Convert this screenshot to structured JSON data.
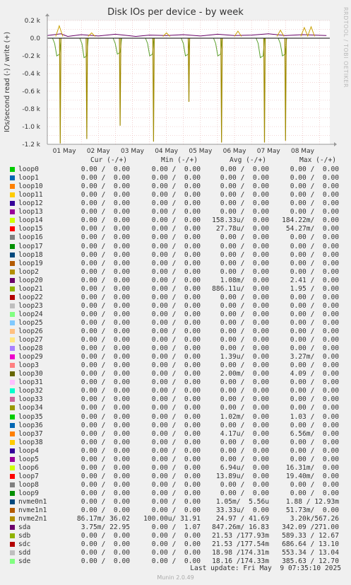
{
  "chart_data": {
    "type": "line",
    "title": "Disk IOs per device - by week",
    "ylabel": "IOs/second read (-) / write (+)",
    "ylim": [
      -1200,
      200
    ],
    "yticks": [
      {
        "v": 200,
        "label": "0.2 k"
      },
      {
        "v": 0,
        "label": "0.0"
      },
      {
        "v": -200,
        "label": "-0.2 k"
      },
      {
        "v": -400,
        "label": "-0.4 k"
      },
      {
        "v": -600,
        "label": "-0.6 k"
      },
      {
        "v": -800,
        "label": "-0.8 k"
      },
      {
        "v": -1000,
        "label": "-1.0 k"
      },
      {
        "v": -1200,
        "label": "-1.2 k"
      }
    ],
    "xlim": [
      0,
      8.3
    ],
    "xticks": [
      {
        "v": 0.5,
        "label": "01 May"
      },
      {
        "v": 1.5,
        "label": "02 May"
      },
      {
        "v": 2.5,
        "label": "03 May"
      },
      {
        "v": 3.5,
        "label": "04 May"
      },
      {
        "v": 4.5,
        "label": "05 May"
      },
      {
        "v": 5.5,
        "label": "06 May"
      },
      {
        "v": 6.5,
        "label": "07 May"
      },
      {
        "v": 7.5,
        "label": "08 May"
      }
    ],
    "grid": true,
    "colors": {
      "background": "#f0f0f0",
      "plot": "#ffffff",
      "grid": "#e8b0b0",
      "zero": "#000000",
      "axis": "#999999"
    },
    "series": [
      {
        "name": "nvme2n1",
        "color": "#a08a00",
        "spikes": [
          {
            "x": 0.38,
            "y": -1190
          },
          {
            "x": 1.16,
            "y": -1140
          },
          {
            "x": 2.14,
            "y": -990
          },
          {
            "x": 3.12,
            "y": -1170
          },
          {
            "x": 4.16,
            "y": -720
          },
          {
            "x": 5.12,
            "y": -1180
          },
          {
            "x": 6.38,
            "y": -1180
          },
          {
            "x": 7.0,
            "y": -1160
          }
        ]
      },
      {
        "name": "sdc",
        "color": "#5aa02c",
        "dips": [
          {
            "x": 0.32,
            "y": -200
          },
          {
            "x": 1.12,
            "y": -220
          },
          {
            "x": 2.1,
            "y": -180
          },
          {
            "x": 3.05,
            "y": -200
          },
          {
            "x": 4.1,
            "y": -200
          },
          {
            "x": 5.05,
            "y": -200
          },
          {
            "x": 6.3,
            "y": -220
          },
          {
            "x": 6.95,
            "y": -200
          }
        ]
      },
      {
        "name": "sda",
        "color": "#660066",
        "values": [
          {
            "x": 0.0,
            "y": 30
          },
          {
            "x": 0.4,
            "y": 50
          },
          {
            "x": 0.6,
            "y": 20
          },
          {
            "x": 1.0,
            "y": 40
          },
          {
            "x": 1.5,
            "y": 25
          },
          {
            "x": 2.0,
            "y": 45
          },
          {
            "x": 2.6,
            "y": 20
          },
          {
            "x": 3.0,
            "y": 35
          },
          {
            "x": 3.5,
            "y": 30
          },
          {
            "x": 4.0,
            "y": 40
          },
          {
            "x": 4.5,
            "y": 25
          },
          {
            "x": 5.0,
            "y": 45
          },
          {
            "x": 5.5,
            "y": 30
          },
          {
            "x": 6.0,
            "y": 35
          },
          {
            "x": 6.5,
            "y": 50
          },
          {
            "x": 7.0,
            "y": 30
          },
          {
            "x": 7.5,
            "y": 40
          },
          {
            "x": 8.2,
            "y": 30
          }
        ]
      },
      {
        "name": "nvme1n1",
        "color": "#a04000",
        "peaks": [
          {
            "x": 0.35,
            "y": 140
          },
          {
            "x": 1.3,
            "y": 60
          },
          {
            "x": 3.5,
            "y": 60
          },
          {
            "x": 5.6,
            "y": 80
          },
          {
            "x": 6.85,
            "y": 90
          },
          {
            "x": 7.55,
            "y": 120
          },
          {
            "x": 7.75,
            "y": 130
          }
        ]
      }
    ]
  },
  "side_text": "RRDTOOL / TOBI OETIKER",
  "legend": {
    "headers": {
      "cur": "Cur (-/+)",
      "min": "Min (-/+)",
      "avg": "Avg (-/+)",
      "max": "Max (-/+)"
    },
    "rows": [
      {
        "name": "loop0",
        "color": "#00cc00",
        "cur": "0.00 /  0.00",
        "min": "0.00 /  0.00",
        "avg": "0.00 /  0.00",
        "max": "0.00 /  0.00"
      },
      {
        "name": "loop1",
        "color": "#0066b3",
        "cur": "0.00 /  0.00",
        "min": "0.00 /  0.00",
        "avg": "0.00 /  0.00",
        "max": "0.00 /  0.00"
      },
      {
        "name": "loop10",
        "color": "#ff8000",
        "cur": "0.00 /  0.00",
        "min": "0.00 /  0.00",
        "avg": "0.00 /  0.00",
        "max": "0.00 /  0.00"
      },
      {
        "name": "loop11",
        "color": "#ffcc00",
        "cur": "0.00 /  0.00",
        "min": "0.00 /  0.00",
        "avg": "0.00 /  0.00",
        "max": "0.00 /  0.00"
      },
      {
        "name": "loop12",
        "color": "#330099",
        "cur": "0.00 /  0.00",
        "min": "0.00 /  0.00",
        "avg": "0.00 /  0.00",
        "max": "0.00 /  0.00"
      },
      {
        "name": "loop13",
        "color": "#990099",
        "cur": "0.00 /  0.00",
        "min": "0.00 /  0.00",
        "avg": "0.00 /  0.00",
        "max": "0.00 /  0.00"
      },
      {
        "name": "loop14",
        "color": "#ccff00",
        "cur": "0.00 /  0.00",
        "min": "0.00 /  0.00",
        "avg": "158.33u/  0.00",
        "max": "184.22m/  0.00"
      },
      {
        "name": "loop15",
        "color": "#ff0000",
        "cur": "0.00 /  0.00",
        "min": "0.00 /  0.00",
        "avg": "27.78u/  0.00",
        "max": "54.27m/  0.00"
      },
      {
        "name": "loop16",
        "color": "#808080",
        "cur": "0.00 /  0.00",
        "min": "0.00 /  0.00",
        "avg": "0.00 /  0.00",
        "max": "0.00 /  0.00"
      },
      {
        "name": "loop17",
        "color": "#008f00",
        "cur": "0.00 /  0.00",
        "min": "0.00 /  0.00",
        "avg": "0.00 /  0.00",
        "max": "0.00 /  0.00"
      },
      {
        "name": "loop18",
        "color": "#00487d",
        "cur": "0.00 /  0.00",
        "min": "0.00 /  0.00",
        "avg": "0.00 /  0.00",
        "max": "0.00 /  0.00"
      },
      {
        "name": "loop19",
        "color": "#b35a00",
        "cur": "0.00 /  0.00",
        "min": "0.00 /  0.00",
        "avg": "0.00 /  0.00",
        "max": "0.00 /  0.00"
      },
      {
        "name": "loop2",
        "color": "#b38f00",
        "cur": "0.00 /  0.00",
        "min": "0.00 /  0.00",
        "avg": "0.00 /  0.00",
        "max": "0.00 /  0.00"
      },
      {
        "name": "loop20",
        "color": "#6b006b",
        "cur": "0.00 /  0.00",
        "min": "0.00 /  0.00",
        "avg": "1.08m/  0.00",
        "max": "2.41 /  0.00"
      },
      {
        "name": "loop21",
        "color": "#8fb300",
        "cur": "0.00 /  0.00",
        "min": "0.00 /  0.00",
        "avg": "886.11u/  0.00",
        "max": "1.95 /  0.00"
      },
      {
        "name": "loop22",
        "color": "#b30000",
        "cur": "0.00 /  0.00",
        "min": "0.00 /  0.00",
        "avg": "0.00 /  0.00",
        "max": "0.00 /  0.00"
      },
      {
        "name": "loop23",
        "color": "#bebebe",
        "cur": "0.00 /  0.00",
        "min": "0.00 /  0.00",
        "avg": "0.00 /  0.00",
        "max": "0.00 /  0.00"
      },
      {
        "name": "loop24",
        "color": "#80ff80",
        "cur": "0.00 /  0.00",
        "min": "0.00 /  0.00",
        "avg": "0.00 /  0.00",
        "max": "0.00 /  0.00"
      },
      {
        "name": "loop25",
        "color": "#80c9ff",
        "cur": "0.00 /  0.00",
        "min": "0.00 /  0.00",
        "avg": "0.00 /  0.00",
        "max": "0.00 /  0.00"
      },
      {
        "name": "loop26",
        "color": "#ffc080",
        "cur": "0.00 /  0.00",
        "min": "0.00 /  0.00",
        "avg": "0.00 /  0.00",
        "max": "0.00 /  0.00"
      },
      {
        "name": "loop27",
        "color": "#ffe680",
        "cur": "0.00 /  0.00",
        "min": "0.00 /  0.00",
        "avg": "0.00 /  0.00",
        "max": "0.00 /  0.00"
      },
      {
        "name": "loop28",
        "color": "#aa80ff",
        "cur": "0.00 /  0.00",
        "min": "0.00 /  0.00",
        "avg": "0.00 /  0.00",
        "max": "0.00 /  0.00"
      },
      {
        "name": "loop29",
        "color": "#ee00cc",
        "cur": "0.00 /  0.00",
        "min": "0.00 /  0.00",
        "avg": "1.39u/  0.00",
        "max": "3.27m/  0.00"
      },
      {
        "name": "loop3",
        "color": "#ff8080",
        "cur": "0.00 /  0.00",
        "min": "0.00 /  0.00",
        "avg": "0.00 /  0.00",
        "max": "0.00 /  0.00"
      },
      {
        "name": "loop30",
        "color": "#666600",
        "cur": "0.00 /  0.00",
        "min": "0.00 /  0.00",
        "avg": "2.00m/  0.00",
        "max": "4.09 /  0.00"
      },
      {
        "name": "loop31",
        "color": "#ffbfff",
        "cur": "0.00 /  0.00",
        "min": "0.00 /  0.00",
        "avg": "0.00 /  0.00",
        "max": "0.00 /  0.00"
      },
      {
        "name": "loop32",
        "color": "#00ffcc",
        "cur": "0.00 /  0.00",
        "min": "0.00 /  0.00",
        "avg": "0.00 /  0.00",
        "max": "0.00 /  0.00"
      },
      {
        "name": "loop33",
        "color": "#cc6699",
        "cur": "0.00 /  0.00",
        "min": "0.00 /  0.00",
        "avg": "0.00 /  0.00",
        "max": "0.00 /  0.00"
      },
      {
        "name": "loop34",
        "color": "#999900",
        "cur": "0.00 /  0.00",
        "min": "0.00 /  0.00",
        "avg": "0.00 /  0.00",
        "max": "0.00 /  0.00"
      },
      {
        "name": "loop35",
        "color": "#00cc00",
        "cur": "0.00 /  0.00",
        "min": "0.00 /  0.00",
        "avg": "1.02m/  0.00",
        "max": "1.03 /  0.00"
      },
      {
        "name": "loop36",
        "color": "#0066b3",
        "cur": "0.00 /  0.00",
        "min": "0.00 /  0.00",
        "avg": "0.00 /  0.00",
        "max": "0.00 /  0.00"
      },
      {
        "name": "loop37",
        "color": "#ff8000",
        "cur": "0.00 /  0.00",
        "min": "0.00 /  0.00",
        "avg": "4.17u/  0.00",
        "max": "6.56m/  0.00"
      },
      {
        "name": "loop38",
        "color": "#ffcc00",
        "cur": "0.00 /  0.00",
        "min": "0.00 /  0.00",
        "avg": "0.00 /  0.00",
        "max": "0.00 /  0.00"
      },
      {
        "name": "loop4",
        "color": "#330099",
        "cur": "0.00 /  0.00",
        "min": "0.00 /  0.00",
        "avg": "0.00 /  0.00",
        "max": "0.00 /  0.00"
      },
      {
        "name": "loop5",
        "color": "#990099",
        "cur": "0.00 /  0.00",
        "min": "0.00 /  0.00",
        "avg": "0.00 /  0.00",
        "max": "0.00 /  0.00"
      },
      {
        "name": "loop6",
        "color": "#ccff00",
        "cur": "0.00 /  0.00",
        "min": "0.00 /  0.00",
        "avg": "6.94u/  0.00",
        "max": "16.31m/  0.00"
      },
      {
        "name": "loop7",
        "color": "#ff0000",
        "cur": "0.00 /  0.00",
        "min": "0.00 /  0.00",
        "avg": "13.89u/  0.00",
        "max": "19.40m/  0.00"
      },
      {
        "name": "loop8",
        "color": "#808080",
        "cur": "0.00 /  0.00",
        "min": "0.00 /  0.00",
        "avg": "0.00 /  0.00",
        "max": "0.00 /  0.00"
      },
      {
        "name": "loop9",
        "color": "#008f00",
        "cur": "0.00 /  0.00",
        "min": "0.00 /  0.00",
        "avg": "0.00 /  0.00",
        "max": "0.00 /  0.00"
      },
      {
        "name": "nvme0n1",
        "color": "#00487d",
        "cur": "0.00 /  0.00",
        "min": "0.00 /  0.00",
        "avg": "1.05m/  5.56u",
        "max": "1.88 / 12.93m"
      },
      {
        "name": "nvme1n1",
        "color": "#b35a00",
        "cur": "0.00 /  0.00",
        "min": "0.00 /  0.00",
        "avg": "33.33u/  0.00",
        "max": "51.73m/  0.00"
      },
      {
        "name": "nvme2n1",
        "color": "#b38f00",
        "cur": "86.17m/ 36.02",
        "min": "100.00u/ 31.91",
        "avg": "24.97 / 41.69",
        "max": "3.20k/567.26"
      },
      {
        "name": "sda",
        "color": "#6b006b",
        "cur": "3.75m/ 22.95",
        "min": "0.00 /  1.07",
        "avg": "847.26m/ 16.83",
        "max": "342.09 /271.00"
      },
      {
        "name": "sdb",
        "color": "#8fb300",
        "cur": "0.00 /  0.00",
        "min": "0.00 /  0.00",
        "avg": "21.53 /177.93m",
        "max": "589.33 / 12.67"
      },
      {
        "name": "sdc",
        "color": "#b30000",
        "cur": "0.00 /  0.00",
        "min": "0.00 /  0.00",
        "avg": "21.53 /177.54m",
        "max": "686.64 / 13.10"
      },
      {
        "name": "sdd",
        "color": "#bebebe",
        "cur": "0.00 /  0.00",
        "min": "0.00 /  0.00",
        "avg": "18.98 /174.31m",
        "max": "553.34 / 13.04"
      },
      {
        "name": "sde",
        "color": "#80ff80",
        "cur": "0.00 /  0.00",
        "min": "0.00 /  0.00",
        "avg": "18.16 /174.33m",
        "max": "385.63 / 12.70"
      }
    ]
  },
  "last_update": "Last update: Fri May  9 07:35:10 2025",
  "footer": "Munin 2.0.49"
}
